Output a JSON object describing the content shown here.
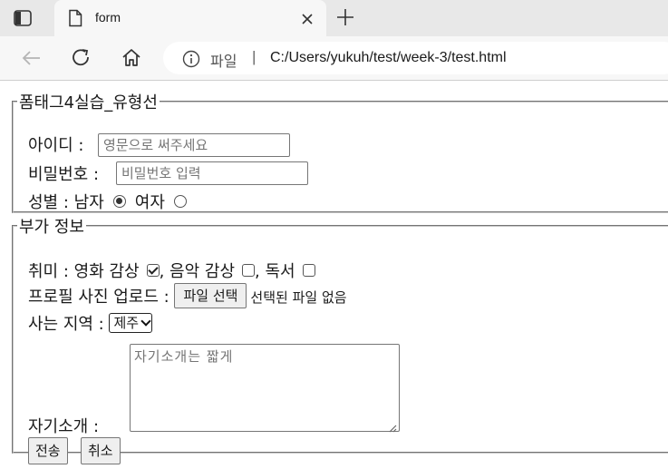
{
  "browser": {
    "tab_title": "form",
    "omnibox_label": "파일",
    "url": "C:/Users/yukuh/test/week-3/test.html"
  },
  "form": {
    "basic": {
      "legend": "폼태그4실습_유형선",
      "id_label": "아이디 :",
      "id_placeholder": "영문으로 써주세요",
      "password_label": "비밀번호 :",
      "password_placeholder": "비밀번호 입력",
      "gender_label": "성별 :",
      "gender_male": "남자",
      "gender_female": "여자",
      "gender_selected": "남자"
    },
    "extra": {
      "legend": "부가 정보",
      "hobby_label": "취미 :",
      "hobby_movie": "영화 감상",
      "hobby_music": ", 음악 감상",
      "hobby_reading": ", 독서",
      "hobby_checked": [
        "영화 감상"
      ],
      "photo_label": "프로필 사진 업로드 :",
      "file_button": "파일 선택",
      "file_status": "선택된 파일 없음",
      "region_label": "사는 지역 :",
      "region_value": "제주",
      "intro_label": "자기소개 :",
      "intro_placeholder": "자기소개는 짧게",
      "submit_label": "전송",
      "reset_label": "취소"
    }
  }
}
